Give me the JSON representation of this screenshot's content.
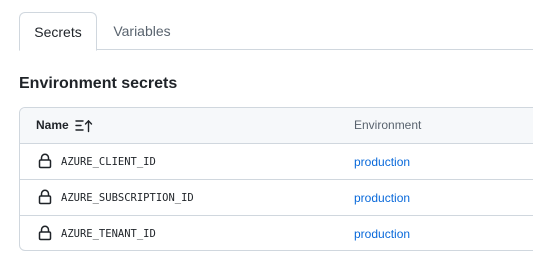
{
  "tabs": [
    {
      "label": "Secrets",
      "selected": true
    },
    {
      "label": "Variables",
      "selected": false
    }
  ],
  "section_title": "Environment secrets",
  "table": {
    "columns": {
      "name": "Name",
      "environment": "Environment"
    },
    "sort_icon": "sort-ascending-icon",
    "rows": [
      {
        "icon": "lock-icon",
        "name": "AZURE_CLIENT_ID",
        "environment": "production"
      },
      {
        "icon": "lock-icon",
        "name": "AZURE_SUBSCRIPTION_ID",
        "environment": "production"
      },
      {
        "icon": "lock-icon",
        "name": "AZURE_TENANT_ID",
        "environment": "production"
      }
    ]
  },
  "colors": {
    "link": "#0969da",
    "border": "#d0d7de",
    "header_bg": "#f6f8fa",
    "muted_text": "#59636e"
  }
}
